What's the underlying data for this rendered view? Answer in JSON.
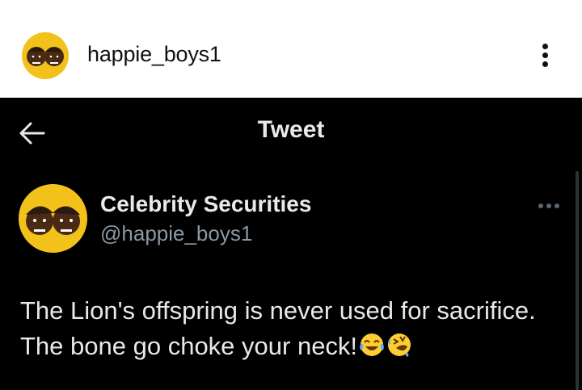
{
  "instagram": {
    "username": "happie_boys1",
    "more_icon": "more-vertical-icon"
  },
  "app_bar": {
    "title": "Tweet",
    "back_icon": "arrow-left-icon"
  },
  "tweet": {
    "display_name": "Celebrity Securities",
    "handle": "@happie_boys1",
    "text_line1": "The Lion's offspring is never used for sacrifice.",
    "text_line2": "The bone go choke your neck!",
    "emojis": [
      "face-with-tears-of-joy",
      "rolling-on-the-floor-laughing"
    ],
    "more_icon": "more-horizontal-icon"
  },
  "colors": {
    "avatar_yellow": "#f2c21b",
    "text_primary": "#e7e9ea",
    "text_secondary": "#8b98a5",
    "background": "#000000"
  }
}
